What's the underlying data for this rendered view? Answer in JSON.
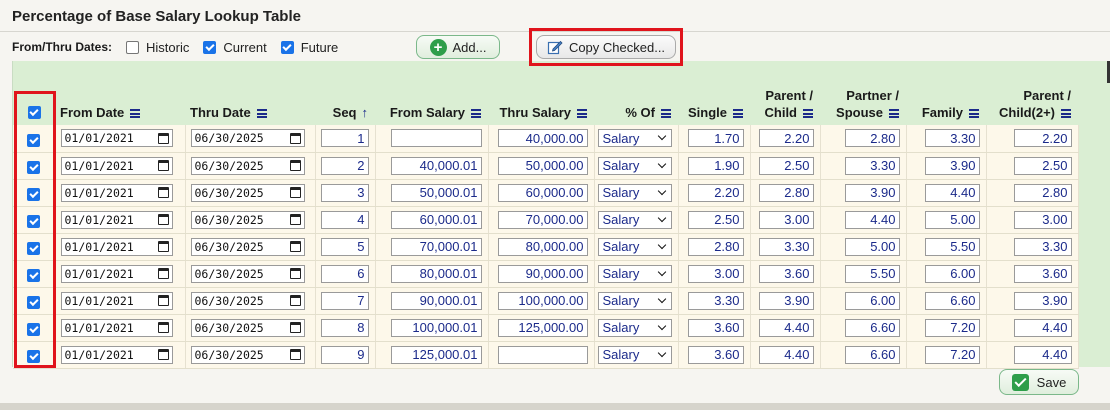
{
  "page": {
    "title": "Percentage of Base Salary Lookup Table"
  },
  "filters": {
    "label": "From/Thru Dates:",
    "options": [
      {
        "label": "Historic",
        "checked": false
      },
      {
        "label": "Current",
        "checked": true
      },
      {
        "label": "Future",
        "checked": true
      }
    ]
  },
  "toolbar": {
    "add_label": "Add...",
    "copy_label": "Copy Checked..."
  },
  "table": {
    "select_all_checked": true,
    "headers": {
      "from_date": "From Date",
      "thru_date": "Thru Date",
      "seq": "Seq",
      "from_salary": "From Salary",
      "thru_salary": "Thru Salary",
      "pct_of": "% Of",
      "single": "Single",
      "parent_child_1": "Parent /",
      "parent_child_2": "Child",
      "partner_spouse_1": "Partner /",
      "partner_spouse_2": "Spouse",
      "family": "Family",
      "parent_children_1": "Parent /",
      "parent_children_2": "Child(2+)"
    },
    "rows": [
      {
        "checked": true,
        "from_date": "01/01/2021",
        "thru_date": "06/30/2025",
        "seq": "1",
        "from_salary": "",
        "thru_salary": "40,000.00",
        "pct_of": "Salary",
        "single": "1.70",
        "parent_child": "2.20",
        "partner_spouse": "2.80",
        "family": "3.30",
        "parent_children": "2.20"
      },
      {
        "checked": true,
        "from_date": "01/01/2021",
        "thru_date": "06/30/2025",
        "seq": "2",
        "from_salary": "40,000.01",
        "thru_salary": "50,000.00",
        "pct_of": "Salary",
        "single": "1.90",
        "parent_child": "2.50",
        "partner_spouse": "3.30",
        "family": "3.90",
        "parent_children": "2.50"
      },
      {
        "checked": true,
        "from_date": "01/01/2021",
        "thru_date": "06/30/2025",
        "seq": "3",
        "from_salary": "50,000.01",
        "thru_salary": "60,000.00",
        "pct_of": "Salary",
        "single": "2.20",
        "parent_child": "2.80",
        "partner_spouse": "3.90",
        "family": "4.40",
        "parent_children": "2.80"
      },
      {
        "checked": true,
        "from_date": "01/01/2021",
        "thru_date": "06/30/2025",
        "seq": "4",
        "from_salary": "60,000.01",
        "thru_salary": "70,000.00",
        "pct_of": "Salary",
        "single": "2.50",
        "parent_child": "3.00",
        "partner_spouse": "4.40",
        "family": "5.00",
        "parent_children": "3.00"
      },
      {
        "checked": true,
        "from_date": "01/01/2021",
        "thru_date": "06/30/2025",
        "seq": "5",
        "from_salary": "70,000.01",
        "thru_salary": "80,000.00",
        "pct_of": "Salary",
        "single": "2.80",
        "parent_child": "3.30",
        "partner_spouse": "5.00",
        "family": "5.50",
        "parent_children": "3.30"
      },
      {
        "checked": true,
        "from_date": "01/01/2021",
        "thru_date": "06/30/2025",
        "seq": "6",
        "from_salary": "80,000.01",
        "thru_salary": "90,000.00",
        "pct_of": "Salary",
        "single": "3.00",
        "parent_child": "3.60",
        "partner_spouse": "5.50",
        "family": "6.00",
        "parent_children": "3.60"
      },
      {
        "checked": true,
        "from_date": "01/01/2021",
        "thru_date": "06/30/2025",
        "seq": "7",
        "from_salary": "90,000.01",
        "thru_salary": "100,000.00",
        "pct_of": "Salary",
        "single": "3.30",
        "parent_child": "3.90",
        "partner_spouse": "6.00",
        "family": "6.60",
        "parent_children": "3.90"
      },
      {
        "checked": true,
        "from_date": "01/01/2021",
        "thru_date": "06/30/2025",
        "seq": "8",
        "from_salary": "100,000.01",
        "thru_salary": "125,000.00",
        "pct_of": "Salary",
        "single": "3.60",
        "parent_child": "4.40",
        "partner_spouse": "6.60",
        "family": "7.20",
        "parent_children": "4.40"
      },
      {
        "checked": true,
        "from_date": "01/01/2021",
        "thru_date": "06/30/2025",
        "seq": "9",
        "from_salary": "125,000.01",
        "thru_salary": "",
        "pct_of": "Salary",
        "single": "3.60",
        "parent_child": "4.40",
        "partner_spouse": "6.60",
        "family": "7.20",
        "parent_children": "4.40"
      }
    ]
  },
  "footer": {
    "save_label": "Save"
  },
  "colors": {
    "header_bg": "#daeed3",
    "row_bg": "#fdf8ea",
    "highlight": "#e0141c",
    "accent": "#1a73e8",
    "button_green": "#2e9e4a"
  }
}
